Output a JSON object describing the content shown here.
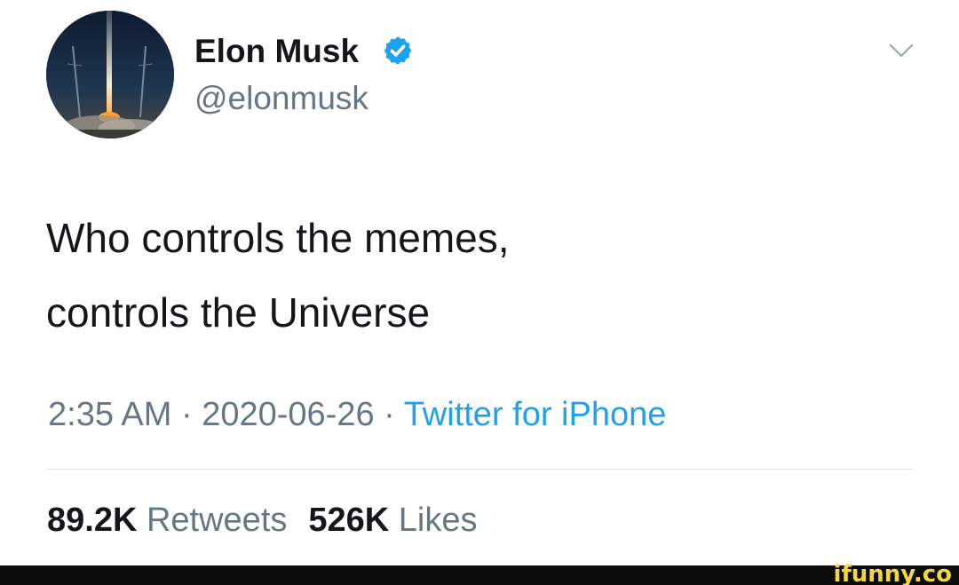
{
  "tweet": {
    "display_name": "Elon Musk",
    "handle": "@elonmusk",
    "text_lines": [
      "Who controls the memes,",
      "controls the Universe"
    ],
    "time": "2:35 AM",
    "separator": "·",
    "date": "2020-06-26",
    "source": "Twitter for iPhone",
    "retweets_count": "89.2K",
    "retweets_label": "Retweets",
    "likes_count": "526K",
    "likes_label": "Likes"
  },
  "icons": {
    "avatar": "rocket-launch-avatar",
    "verified": "verified-badge-icon",
    "menu": "chevron-down-icon"
  },
  "watermark": "ifunny.co",
  "colors": {
    "text_primary": "#14171a",
    "text_secondary": "#657786",
    "link": "#1da1f2",
    "verified": "#1da1f2",
    "watermark": "#f4d63e",
    "footer_bar": "#0c0c0c"
  }
}
